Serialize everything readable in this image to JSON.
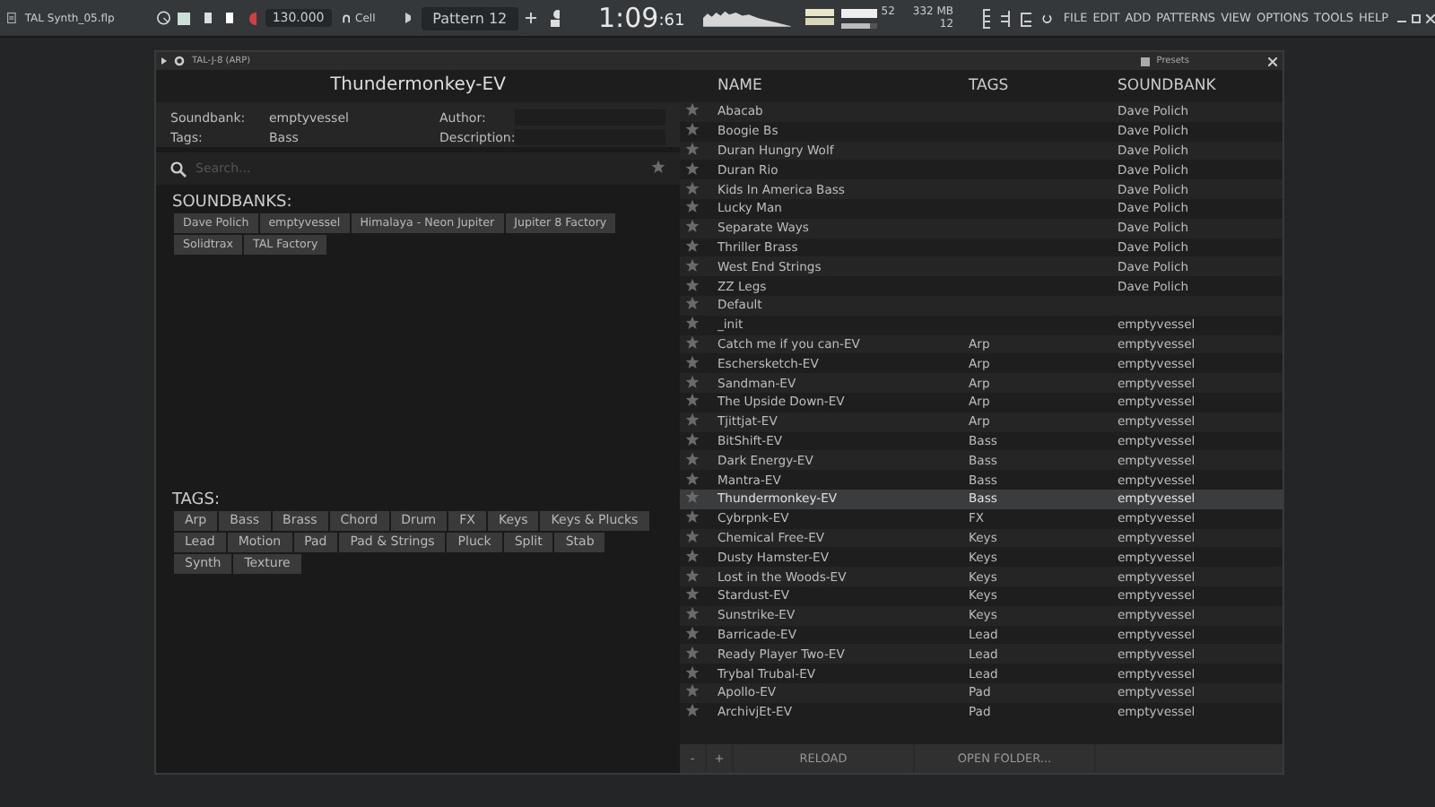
{
  "app_bar": {
    "file_name": "TAL Synth_05.flp",
    "tempo": "130.000",
    "snap": "Cell",
    "pattern": "Pattern 12",
    "time": "1:09",
    "time_fraction": ":61",
    "cpu": "52",
    "volume": {
      "level": 0.8
    },
    "memory": "332 MB",
    "polyphony": "12",
    "menu": [
      "FILE",
      "EDIT",
      "ADD",
      "PATTERNS",
      "VIEW",
      "OPTIONS",
      "TOOLS",
      "HELP"
    ]
  },
  "plugin_window": {
    "title": "TAL-J-8 (ARP)",
    "presets_label": "Presets"
  },
  "preset_info": {
    "name": "Thundermonkey-EV",
    "fields": [
      {
        "label": "Soundbank:",
        "value": "emptyvessel"
      },
      {
        "label": "Author:"
      },
      {
        "label": "Tags:",
        "value": "Bass"
      },
      {
        "label": "Description:"
      }
    ]
  },
  "search": {
    "placeholder": "Search..."
  },
  "soundbanks": {
    "heading": "SOUNDBANKS:",
    "items": [
      "Dave Polich",
      "emptyvessel",
      "Himalaya - Neon Jupiter",
      "Jupiter 8 Factory",
      "Solidtrax",
      "TAL Factory"
    ]
  },
  "tags": {
    "heading": "TAGS:",
    "items": [
      "Arp",
      "Bass",
      "Brass",
      "Chord",
      "Drum",
      "FX",
      "Keys",
      "Keys & Plucks",
      "Lead",
      "Motion",
      "Pad",
      "Pad & Strings",
      "Pluck",
      "Split",
      "Stab",
      "Synth",
      "Texture"
    ]
  },
  "preset_list": {
    "columns": [
      "NAME",
      "TAGS",
      "SOUNDBANK"
    ],
    "rows": [
      {
        "name": "Abacab",
        "soundbank": "Dave Polich",
        "selected": false
      },
      {
        "name": "Boogie Bs",
        "soundbank": "Dave Polich",
        "selected": false
      },
      {
        "name": "Duran Hungry Wolf",
        "soundbank": "Dave Polich",
        "selected": false
      },
      {
        "name": "Duran Rio",
        "soundbank": "Dave Polich",
        "selected": false
      },
      {
        "name": "Kids In America Bass",
        "soundbank": "Dave Polich",
        "selected": false
      },
      {
        "name": "Lucky Man",
        "soundbank": "Dave Polich",
        "selected": false
      },
      {
        "name": "Separate Ways",
        "soundbank": "Dave Polich",
        "selected": false
      },
      {
        "name": "Thriller Brass",
        "soundbank": "Dave Polich",
        "selected": false
      },
      {
        "name": "West End Strings",
        "soundbank": "Dave Polich",
        "selected": false
      },
      {
        "name": "ZZ Legs",
        "soundbank": "Dave Polich",
        "selected": false
      },
      {
        "name": "Default",
        "selected": false
      },
      {
        "name": "_init",
        "soundbank": "emptyvessel",
        "selected": false
      },
      {
        "name": "Catch me if you can-EV",
        "tag": "Arp",
        "soundbank": "emptyvessel",
        "selected": false
      },
      {
        "name": "Eschersketch-EV",
        "tag": "Arp",
        "soundbank": "emptyvessel",
        "selected": false
      },
      {
        "name": "Sandman-EV",
        "tag": "Arp",
        "soundbank": "emptyvessel",
        "selected": false
      },
      {
        "name": "The Upside Down-EV",
        "tag": "Arp",
        "soundbank": "emptyvessel",
        "selected": false
      },
      {
        "name": "Tjittjat-EV",
        "tag": "Arp",
        "soundbank": "emptyvessel",
        "selected": false
      },
      {
        "name": "BitShift-EV",
        "tag": "Bass",
        "soundbank": "emptyvessel",
        "selected": false
      },
      {
        "name": "Dark Energy-EV",
        "tag": "Bass",
        "soundbank": "emptyvessel",
        "selected": false
      },
      {
        "name": "Mantra-EV",
        "tag": "Bass",
        "soundbank": "emptyvessel",
        "selected": false
      },
      {
        "name": "Thundermonkey-EV",
        "tag": "Bass",
        "soundbank": "emptyvessel",
        "selected": true
      },
      {
        "name": "Cybrpnk-EV",
        "tag": "FX",
        "soundbank": "emptyvessel",
        "selected": false
      },
      {
        "name": "Chemical Free-EV",
        "tag": "Keys",
        "soundbank": "emptyvessel",
        "selected": false
      },
      {
        "name": "Dusty Hamster-EV",
        "tag": "Keys",
        "soundbank": "emptyvessel",
        "selected": false
      },
      {
        "name": "Lost in the Woods-EV",
        "tag": "Keys",
        "soundbank": "emptyvessel",
        "selected": false
      },
      {
        "name": "Stardust-EV",
        "tag": "Keys",
        "soundbank": "emptyvessel",
        "selected": false
      },
      {
        "name": "Sunstrike-EV",
        "tag": "Keys",
        "soundbank": "emptyvessel",
        "selected": false
      },
      {
        "name": "Barricade-EV",
        "tag": "Lead",
        "soundbank": "emptyvessel",
        "selected": false
      },
      {
        "name": "Ready Player Two-EV",
        "tag": "Lead",
        "soundbank": "emptyvessel",
        "selected": false
      },
      {
        "name": "Trybal Trubal-EV",
        "tag": "Lead",
        "soundbank": "emptyvessel",
        "selected": false
      },
      {
        "name": "Apollo-EV",
        "tag": "Pad",
        "soundbank": "emptyvessel",
        "selected": false
      },
      {
        "name": "ArchivjEt-EV",
        "tag": "Pad",
        "soundbank": "emptyvessel",
        "selected": false
      }
    ]
  },
  "footer_buttons": [
    "-",
    "+",
    "RELOAD",
    "OPEN FOLDER..."
  ]
}
